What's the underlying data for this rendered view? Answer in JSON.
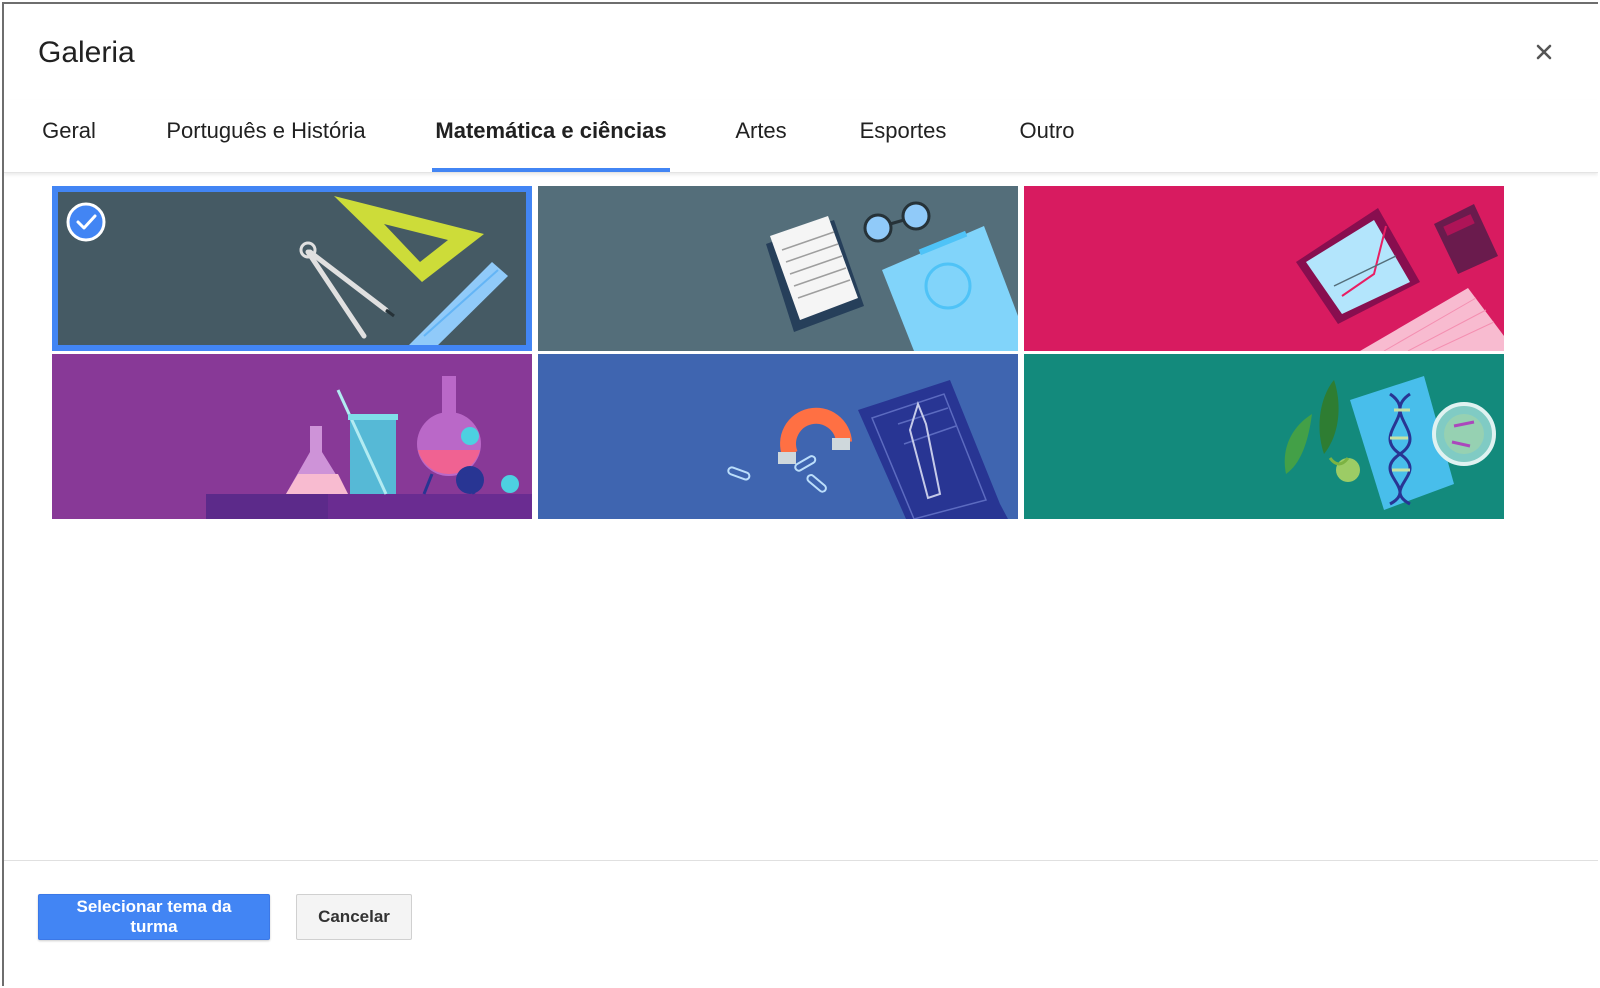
{
  "dialog": {
    "title": "Galeria",
    "close_icon": "close-icon"
  },
  "tabs": [
    {
      "label": "Geral",
      "active": false
    },
    {
      "label": "Português e História",
      "active": false
    },
    {
      "label": "Matemática e ciências",
      "active": true
    },
    {
      "label": "Artes",
      "active": false
    },
    {
      "label": "Esportes",
      "active": false
    },
    {
      "label": "Outro",
      "active": false
    }
  ],
  "gallery": {
    "tiles": [
      {
        "theme": "geometry-tools",
        "background": "#455a64",
        "selected": true
      },
      {
        "theme": "notebook-and-glasses",
        "background": "#546e7a",
        "selected": false
      },
      {
        "theme": "tablet-calculator",
        "background": "#d81b60",
        "selected": false
      },
      {
        "theme": "chemistry-flasks",
        "background": "#883997",
        "selected": false
      },
      {
        "theme": "magnet-rocket-blueprint",
        "background": "#3f65b0",
        "selected": false
      },
      {
        "theme": "biology-dna",
        "background": "#138a7c",
        "selected": false
      }
    ],
    "accent_color": "#4285f4"
  },
  "footer": {
    "primary_label": "Selecionar tema da turma",
    "secondary_label": "Cancelar"
  }
}
